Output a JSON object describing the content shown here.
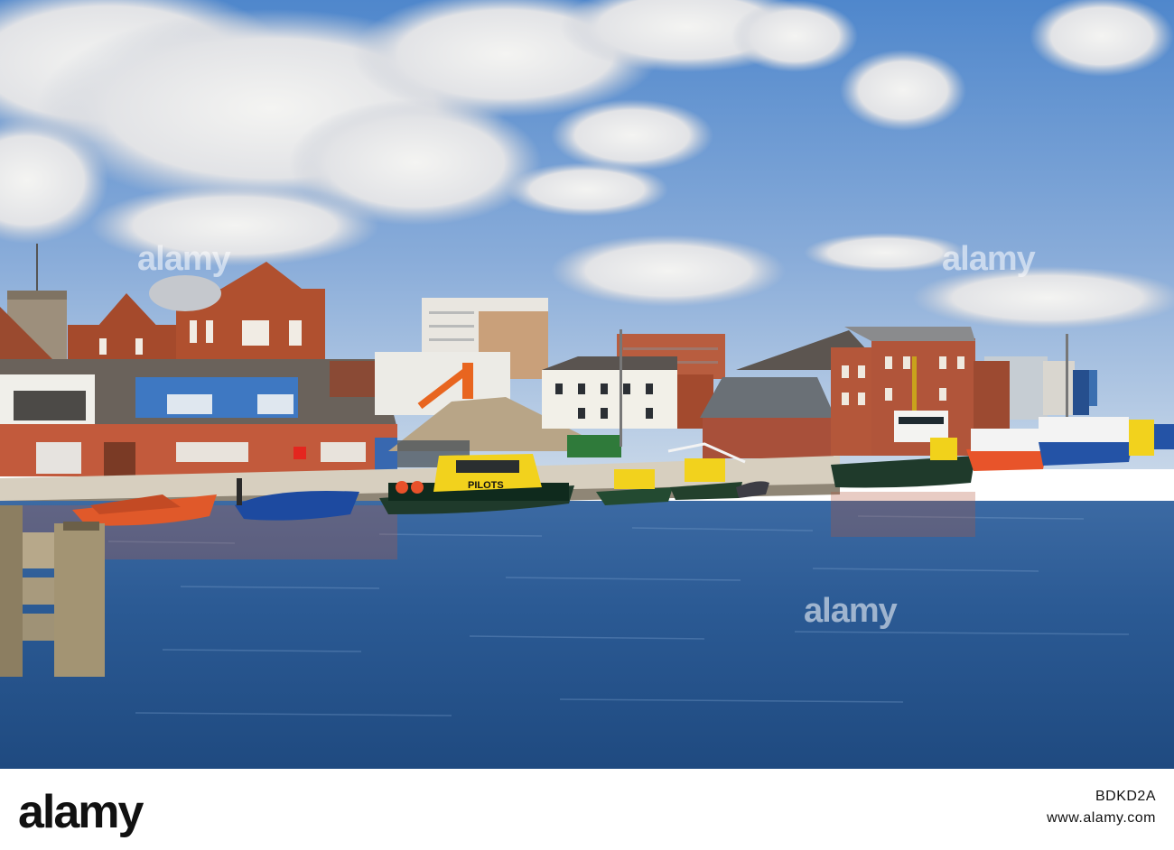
{
  "scene": {
    "description_free": true,
    "boat_labels": {
      "pilot_boat": "PILOTS"
    },
    "colors": {
      "sky_top": "#5b8fd0",
      "sky_bottom": "#b9cfe6",
      "water": "#2e5f99",
      "brick": "#a24a2e",
      "pilot_boat": "#f2d21d",
      "tug_hull": "#1f3a2b"
    }
  },
  "watermark": {
    "text": "alamy"
  },
  "footer": {
    "logo": "alamy",
    "image_id": "BDKD2A",
    "url": "www.alamy.com"
  }
}
